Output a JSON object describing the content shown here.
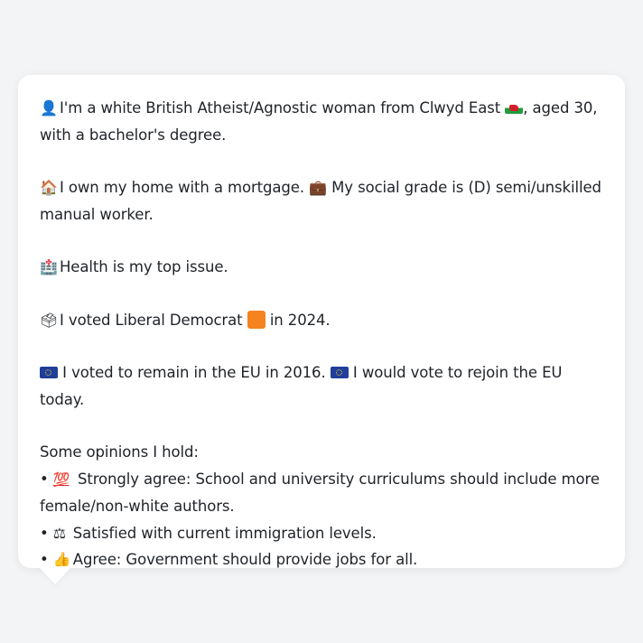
{
  "profile": {
    "line1_icon": "person-silhouette-icon",
    "line1_text_a": "I'm a white British Atheist/Agnostic woman from Clwyd East",
    "line1_flag": "wales-flag-icon",
    "line1_text_b": ", aged 30,",
    "line2_text": "with a bachelor's degree.",
    "home_icon": "house-icon",
    "home_text": "I own my home with a mortgage.",
    "briefcase_icon": "briefcase-icon",
    "grade_text": "My social grade is (D) semi/unskilled",
    "grade_text_2": "manual worker.",
    "health_icon": "hospital-icon",
    "health_text": "Health is my top issue.",
    "vote_icon": "ballot-box-icon",
    "vote_text_a": "I voted Liberal Democrat",
    "vote_party_icon": "orange-square-icon",
    "vote_text_b": "in 2024.",
    "eu_icon": "eu-flag-icon",
    "eu_text_a": "I voted to remain in the EU in 2016.",
    "eu_text_b": "I would vote to rejoin the EU today.",
    "opinions_heading": "Some opinions I hold:",
    "opinions": [
      {
        "bullet": "•",
        "icon": "hundred-points-icon",
        "text": "Strongly agree: School and university curriculums should include more",
        "text_cont": "female/non-white authors."
      },
      {
        "bullet": "•",
        "icon": "balance-scale-icon",
        "text": "Satisfied with current immigration levels."
      },
      {
        "bullet": "•",
        "icon": "thumbs-up-icon",
        "text": "Agree: Government should provide jobs for all."
      }
    ]
  },
  "colors": {
    "background": "#f3f4f6",
    "card": "#ffffff",
    "text": "#1f2328",
    "liberal_democrat_orange": "#f5831f"
  }
}
